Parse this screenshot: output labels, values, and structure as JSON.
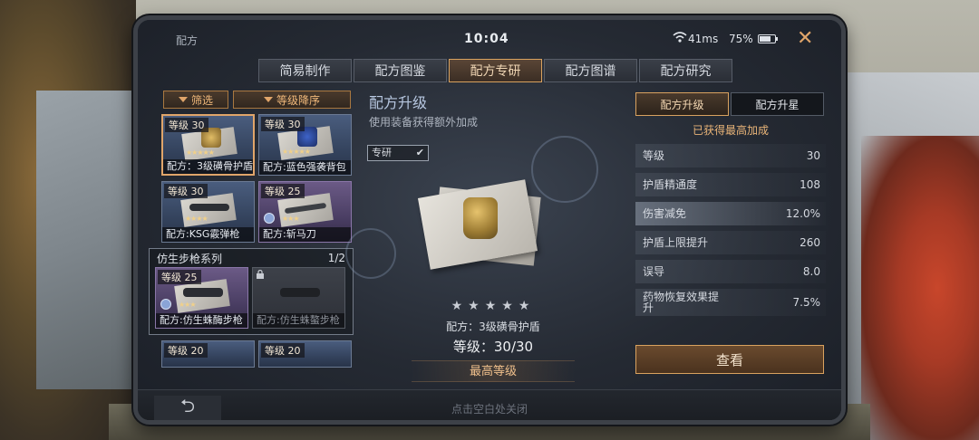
{
  "window": {
    "title": "配方",
    "time": "10:04",
    "ping": "41ms",
    "battery": "75%",
    "battery_level": 0.75
  },
  "tabs": [
    {
      "label": "简易制作",
      "active": false
    },
    {
      "label": "配方图鉴",
      "active": false
    },
    {
      "label": "配方专研",
      "active": true
    },
    {
      "label": "配方图谱",
      "active": false
    },
    {
      "label": "配方研究",
      "active": false
    }
  ],
  "filters": {
    "filter_label": "筛选",
    "sort_label": "等级降序"
  },
  "cards": [
    {
      "level": "等级 30",
      "name": "配方：3级磺骨护盾",
      "stars": "★★★★★"
    },
    {
      "level": "等级 30",
      "name": "配方:蓝色强袭背包",
      "stars": "★★★★★"
    },
    {
      "level": "等级 30",
      "name": "配方:KSG霰弹枪",
      "stars": "★★★★"
    },
    {
      "level": "等级 25",
      "name": "配方:斩马刀",
      "stars": "★★★"
    }
  ],
  "series": {
    "title": "仿生步枪系列",
    "page": "1/2",
    "cards": [
      {
        "level": "等级 25",
        "name": "配方:仿生蛛酶步枪",
        "stars": "★★★"
      },
      {
        "level": "",
        "name": "配方:仿生蛛螯步枪",
        "stars": ""
      }
    ]
  },
  "bottom_cards": [
    {
      "level": "等级 20"
    },
    {
      "level": "等级 20"
    }
  ],
  "detail": {
    "heading": "配方升级",
    "subheading": "使用装备获得额外加成",
    "tag": "专研",
    "tag_check": "✔",
    "stars": "★★★★★",
    "recipe": "配方：3级磺骨护盾",
    "level": "等级：30/30",
    "max_button": "最高等级"
  },
  "right": {
    "seg_upgrade": "配方升级",
    "seg_star": "配方升星",
    "note": "已获得最高加成",
    "stats": [
      {
        "k": "等级",
        "v": "30"
      },
      {
        "k": "护盾精通度",
        "v": "108"
      },
      {
        "k": "伤害减免",
        "v": "12.0%"
      },
      {
        "k": "护盾上限提升",
        "v": "260"
      },
      {
        "k": "误导",
        "v": "8.0"
      },
      {
        "k": "药物恢复效果提升",
        "v": "7.5%"
      }
    ],
    "view_button": "查看"
  },
  "footer": {
    "back": "⮌",
    "hint": "点击空白处关闭"
  },
  "colors": {
    "accent": "#d9a25f",
    "accent_text": "#f0c08c"
  }
}
